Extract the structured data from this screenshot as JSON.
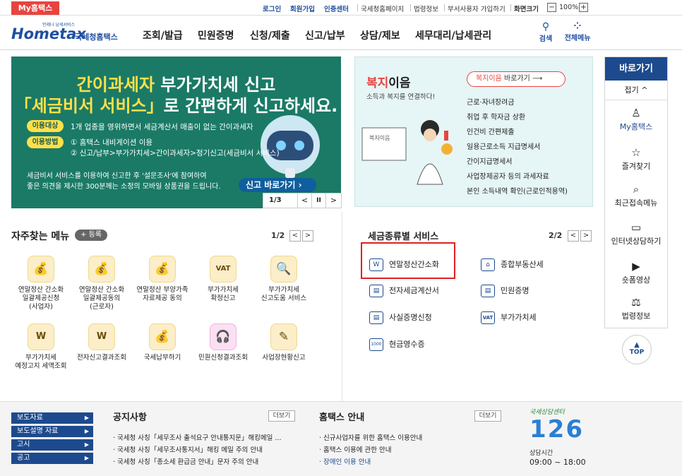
{
  "util": {
    "myhome": "My홈택스",
    "login": "로그인",
    "join": "회원가입",
    "cert": "인증센터",
    "links": [
      "국세청홈페이지",
      "법령정보",
      "부서사용자 가입하기"
    ],
    "screen": "화면크기",
    "zoom": "100%",
    "minus": "−",
    "plus": "+"
  },
  "logo": {
    "small": "언제나 납세서비스",
    "main": "Hometax",
    "suffix": "국세청홈택스"
  },
  "gnb": [
    "조회/발급",
    "민원증명",
    "신청/제출",
    "신고/납부",
    "상담/제보",
    "세무대리/납세관리"
  ],
  "header": {
    "search": "검색",
    "allmenu": "전체메뉴"
  },
  "banner": {
    "line1_a": "간이과세자",
    "line1_b": " 부가가치세 신고",
    "line2_a": "「세금비서 서비스」",
    "line2_b": "로 간편하게 신고",
    "line2_c": "하세요.",
    "pill1": "이용대상",
    "txt1": "1개 업종을 영위하면서 세금계산서 매출이 없는 간이과세자",
    "pill2": "이용방법",
    "txt2a": "① 홈택스 내비게이션 이용",
    "txt2b": "② 신고/납부>부가가치세>간이과세자>정기신고(세금비서 서비스)",
    "s1": "세금비서 서비스를 이용하여 신고한 후 '설문조사'에 참여하여",
    "s2": "좋은 의견을 제시한 300분께는 소정의 모바일 상품권을 드립니다.",
    "go": "신고 바로가기",
    "page": "1/3",
    "prev": "<",
    "pause": "II",
    "next": ">"
  },
  "welfare": {
    "t1": "복지",
    "t2": "이음",
    "sub": "소득과 복지를 연결하다!",
    "go_a": "복지이음",
    "go_b": " 바로가기",
    "items": [
      "근로·자녀장려금",
      "취업 후 학자금 상환",
      "인건비 간편제출",
      "일용근로소득 지급명세서",
      "간이지급명세서",
      "사업장제공자 등의 과세자료",
      "본인 소득내역 확인(근로인적용역)"
    ],
    "card": "복지이음"
  },
  "quick": {
    "head": "바로가기",
    "fold": "접기 ^",
    "items": [
      {
        "icon": "My",
        "label": "My홈택스"
      },
      {
        "icon": "☆",
        "label": "즐겨찾기"
      },
      {
        "icon": "🔍",
        "label": "최근접속메뉴"
      },
      {
        "icon": "▭",
        "label": "인터넷상담하기"
      },
      {
        "icon": "▶",
        "label": "숏폼영상"
      },
      {
        "icon": "⚖",
        "label": "법령정보"
      }
    ],
    "top": "TOP"
  },
  "freq": {
    "title": "자주찾는 메뉴",
    "reg": "+ 등록",
    "page": "1/2",
    "prev": "<",
    "next": ">",
    "items": [
      [
        "연말정산 간소화",
        "일괄제공신청",
        "(사업자)"
      ],
      [
        "연말정산 간소화",
        "일괄제공동의",
        "(근로자)"
      ],
      [
        "연말정산 부양가족",
        "자료제공 동의"
      ],
      [
        "부가가치세",
        "확정신고"
      ],
      [
        "부가가치세",
        "신고도움 서비스"
      ],
      [
        "부가가치세",
        "예정고지 세액조회"
      ],
      [
        "전자신고결과조회"
      ],
      [
        "국세납부하기"
      ],
      [
        "민원신청결과조회"
      ],
      [
        "사업장현황신고"
      ]
    ]
  },
  "tax": {
    "title": "세금종류별 서비스",
    "page": "2/2",
    "prev": "<",
    "next": ">",
    "items": [
      {
        "icon": "W",
        "label": "연말정산간소화"
      },
      {
        "icon": "⌂",
        "label": "종합부동산세"
      },
      {
        "icon": "▤",
        "label": "전자세금계산서"
      },
      {
        "icon": "▤",
        "label": "민원증명"
      },
      {
        "icon": "▤",
        "label": "사실증명신청"
      },
      {
        "icon": "VAT",
        "label": "부가가치세"
      },
      {
        "icon": "1000",
        "label": "현금영수증"
      }
    ]
  },
  "footer": {
    "tabs": [
      "보도자료",
      "보도설명 자료",
      "고시",
      "공고"
    ],
    "notice": "공지사항",
    "more": "더보기",
    "notices": [
      "국세청 사칭「세무조사 출석요구 안내통지문」해킹메일 ...",
      "국세청 사칭「세무조사통지서」해킹 메일 주의 안내",
      "국세청 사칭「종소세 환급금 안내」문자 주의 안내"
    ],
    "guide": "홈택스 안내",
    "guides": [
      "신규사업자를 위한 홈택스 이용안내",
      "홈택스 이용에 관한 안내",
      "장애인 이용 안내"
    ],
    "cc_title": "국세상담센터",
    "cc_num": "126",
    "cc_hours_label": "상담시간",
    "cc_hours": "09:00 ~ 18:00"
  }
}
